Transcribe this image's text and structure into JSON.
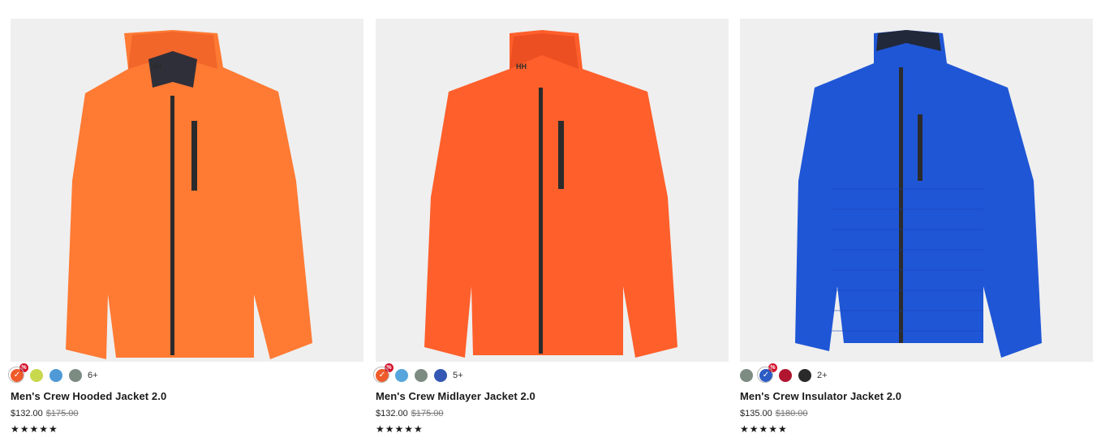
{
  "products": [
    {
      "title": "Men's Crew Hooded Jacket 2.0",
      "price": "$132.00",
      "was_price": "$175.00",
      "rating_stars": "★★★★★",
      "more_colors": "6+",
      "sale_badge": "%",
      "check": "✓",
      "jacket_color": "#ff7a33",
      "jacket_shade": "#f2662a",
      "swatches": [
        "#ef5b2b",
        "#c9d94e",
        "#4f9ad6",
        "#7d8c82"
      ]
    },
    {
      "title": "Men's Crew Midlayer Jacket 2.0",
      "price": "$132.00",
      "was_price": "$175.00",
      "rating_stars": "★★★★★",
      "more_colors": "5+",
      "sale_badge": "%",
      "check": "✓",
      "jacket_color": "#ff5f2b",
      "jacket_shade": "#ec4f22",
      "swatches": [
        "#ef5b2b",
        "#56a5dc",
        "#7d8c82",
        "#3558b4"
      ]
    },
    {
      "title": "Men's Crew Insulator Jacket 2.0",
      "price": "$135.00",
      "was_price": "$180.00",
      "rating_stars": "★★★★★",
      "more_colors": "2+",
      "sale_badge": "%",
      "check": "✓",
      "jacket_color": "#1f56d6",
      "jacket_shade": "#1646b8",
      "swatches": [
        "#7d8c82",
        "#2c5cc4",
        "#b0162f",
        "#2a2a2a"
      ]
    }
  ]
}
